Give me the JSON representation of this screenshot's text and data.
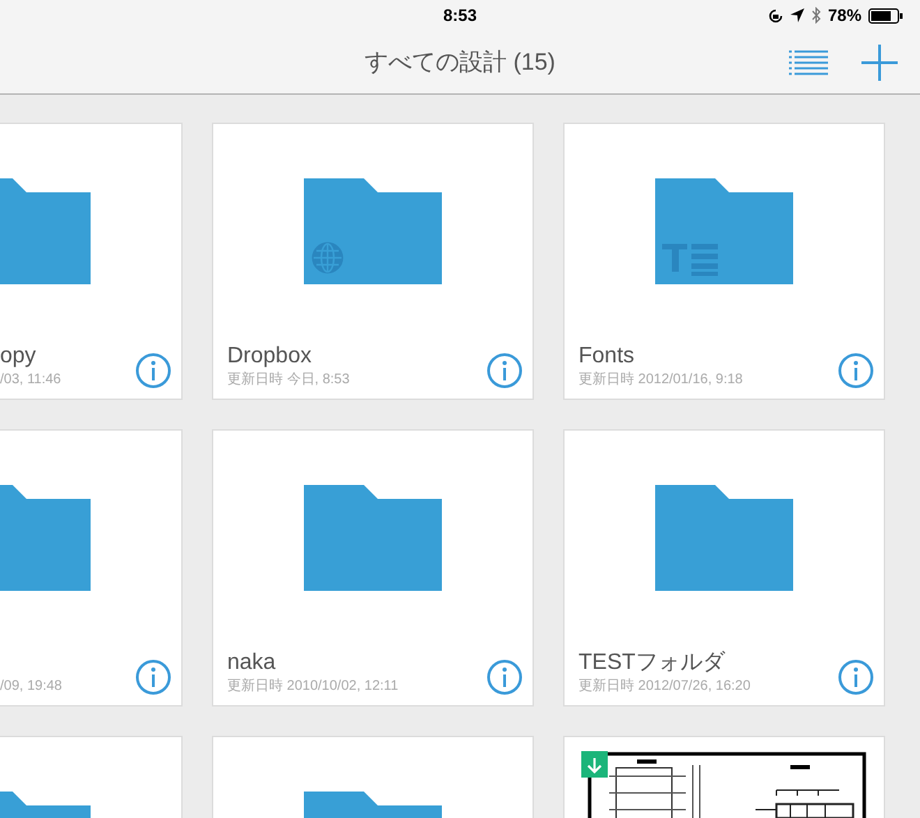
{
  "status_bar": {
    "time": "8:53",
    "battery": "78%"
  },
  "nav_bar": {
    "title": "すべての設計 (15)"
  },
  "items": [
    {
      "kind": "folder",
      "name": "opy",
      "modified": "/03, 11:46"
    },
    {
      "kind": "folder",
      "emblem": {
        "kind": "globe"
      },
      "name": "Dropbox",
      "modified": "更新日時 今日, 8:53"
    },
    {
      "kind": "folder",
      "emblem": {
        "kind": "fonts"
      },
      "name": "Fonts",
      "modified": "更新日時 2012/01/16, 9:18"
    },
    {
      "kind": "folder",
      "modified": "/09, 19:48"
    },
    {
      "kind": "folder",
      "name": "naka",
      "modified": "更新日時 2010/10/02, 12:11"
    },
    {
      "kind": "folder",
      "name": "TESTフォルダ",
      "modified": "更新日時 2012/07/26, 16:20"
    },
    {
      "kind": "folder"
    },
    {
      "kind": "folder"
    },
    {
      "kind": "drawing",
      "downloaded": true
    }
  ]
}
